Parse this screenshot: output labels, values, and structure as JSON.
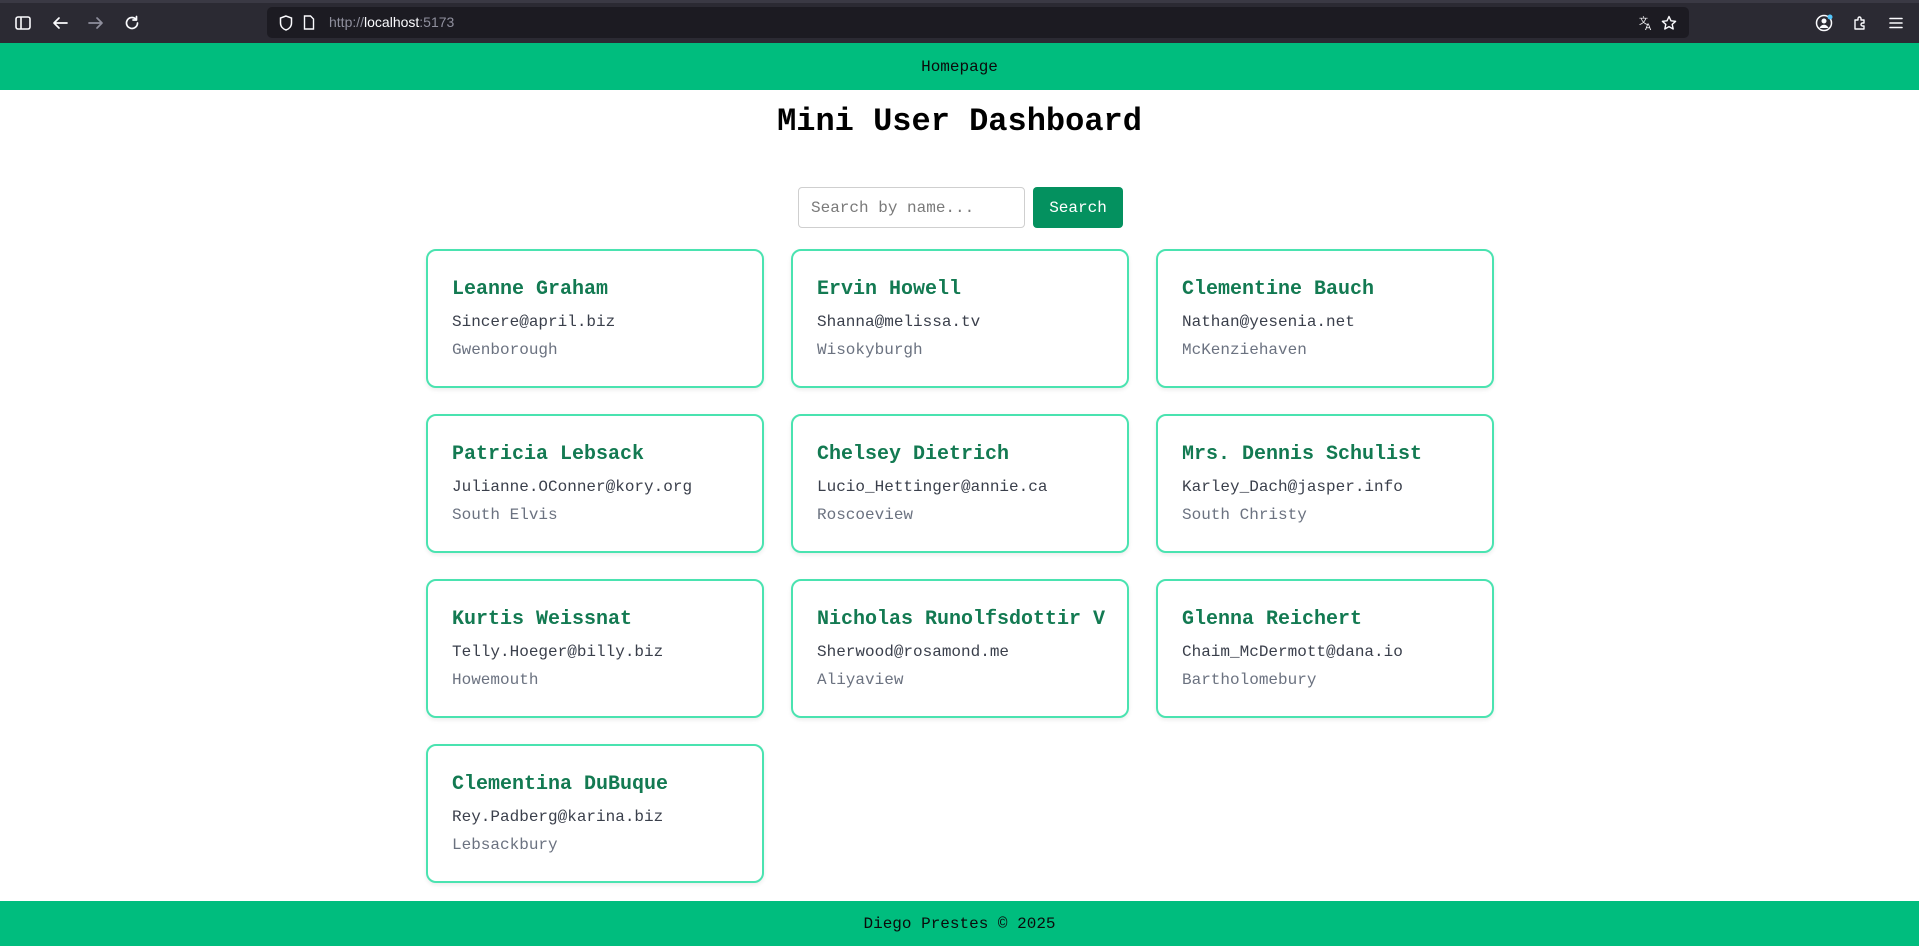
{
  "browser": {
    "url_protocol": "http://",
    "url_host": "localhost",
    "url_port": ":5173",
    "icons": [
      "sidebar-icon",
      "back-icon",
      "forward-icon",
      "reload-icon",
      "shield-icon",
      "page-icon",
      "translate-icon",
      "bookmark-star-icon",
      "account-icon",
      "extensions-icon",
      "menu-icon"
    ]
  },
  "header": {
    "nav_home": "Homepage"
  },
  "main": {
    "title": "Mini User Dashboard",
    "search": {
      "placeholder": "Search by name...",
      "value": "",
      "button_label": "Search"
    },
    "users": [
      {
        "name": "Leanne Graham",
        "email": "Sincere@april.biz",
        "city": "Gwenborough"
      },
      {
        "name": "Ervin Howell",
        "email": "Shanna@melissa.tv",
        "city": "Wisokyburgh"
      },
      {
        "name": "Clementine Bauch",
        "email": "Nathan@yesenia.net",
        "city": "McKenziehaven"
      },
      {
        "name": "Patricia Lebsack",
        "email": "Julianne.OConner@kory.org",
        "city": "South Elvis"
      },
      {
        "name": "Chelsey Dietrich",
        "email": "Lucio_Hettinger@annie.ca",
        "city": "Roscoeview"
      },
      {
        "name": "Mrs. Dennis Schulist",
        "email": "Karley_Dach@jasper.info",
        "city": "South Christy"
      },
      {
        "name": "Kurtis Weissnat",
        "email": "Telly.Hoeger@billy.biz",
        "city": "Howemouth"
      },
      {
        "name": "Nicholas Runolfsdottir V",
        "email": "Sherwood@rosamond.me",
        "city": "Aliyaview"
      },
      {
        "name": "Glenna Reichert",
        "email": "Chaim_McDermott@dana.io",
        "city": "Bartholomebury"
      },
      {
        "name": "Clementina DuBuque",
        "email": "Rey.Padberg@karina.biz",
        "city": "Lebsackbury"
      }
    ]
  },
  "footer": {
    "text": "Diego Prestes © 2025"
  },
  "colors": {
    "accent": "#00bd7e",
    "button": "#04915f",
    "card_border": "#4ae3b0",
    "card_title": "#137a52"
  }
}
